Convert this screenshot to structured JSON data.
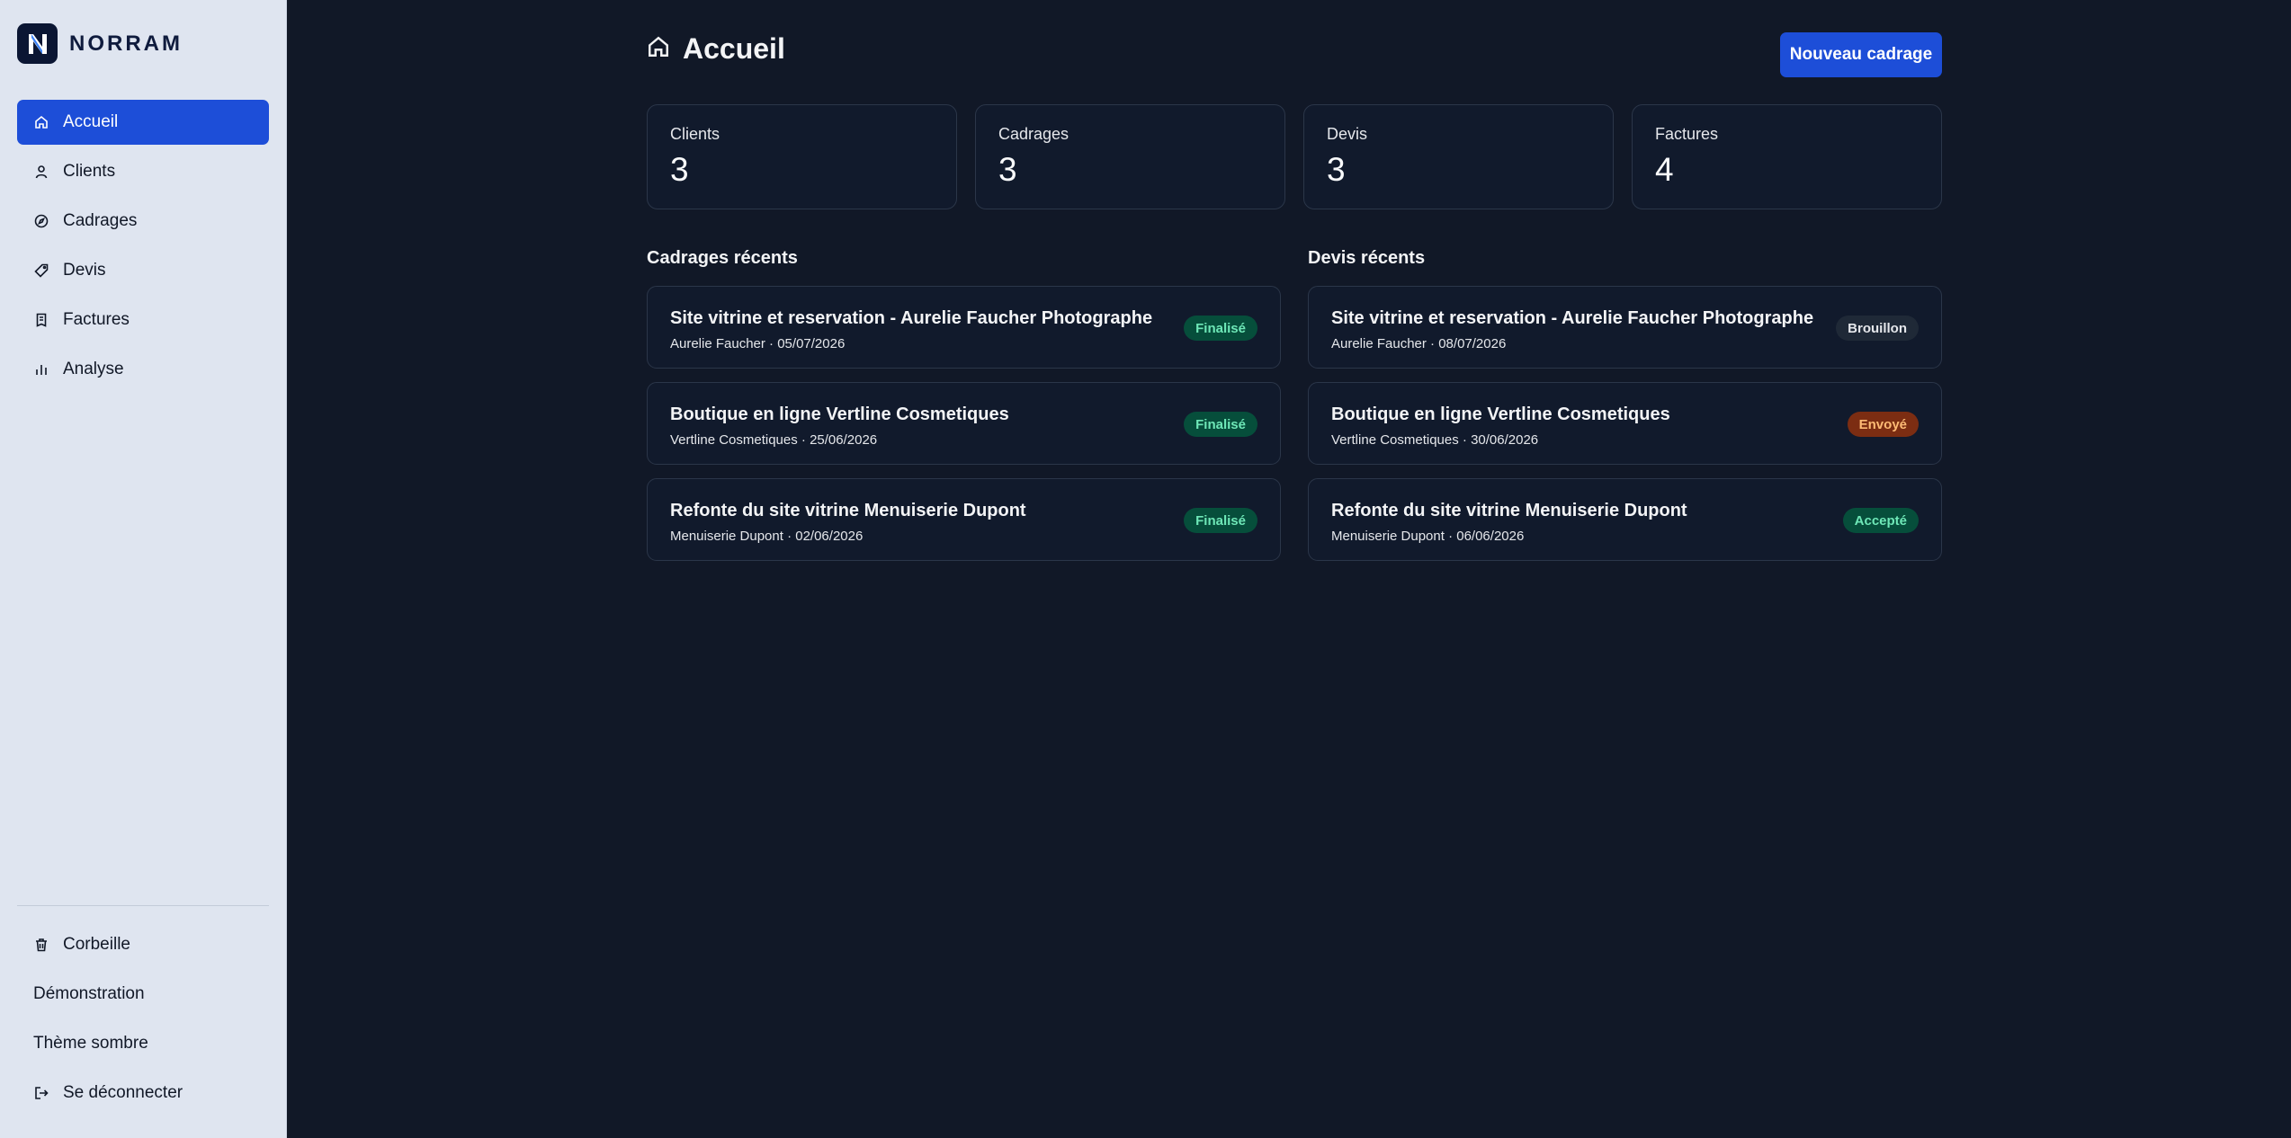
{
  "brand": {
    "name": "NORRAM"
  },
  "sidebar": {
    "items": [
      {
        "label": "Accueil",
        "icon": "home-icon",
        "active": true
      },
      {
        "label": "Clients",
        "icon": "user-icon"
      },
      {
        "label": "Cadrages",
        "icon": "compass-icon"
      },
      {
        "label": "Devis",
        "icon": "tag-icon"
      },
      {
        "label": "Factures",
        "icon": "receipt-icon"
      },
      {
        "label": "Analyse",
        "icon": "bar-chart-icon"
      }
    ],
    "bottom": [
      {
        "label": "Corbeille",
        "icon": "trash-icon"
      },
      {
        "label": "Démonstration"
      },
      {
        "label": "Thème sombre"
      },
      {
        "label": "Se déconnecter",
        "icon": "logout-icon"
      }
    ]
  },
  "header": {
    "title": "Accueil",
    "new_button": "Nouveau cadrage"
  },
  "stats": [
    {
      "label": "Clients",
      "value": "3"
    },
    {
      "label": "Cadrages",
      "value": "3"
    },
    {
      "label": "Devis",
      "value": "3"
    },
    {
      "label": "Factures",
      "value": "4"
    }
  ],
  "cadrages": {
    "title": "Cadrages récents",
    "items": [
      {
        "title": "Site vitrine et reservation - Aurelie Faucher Photographe",
        "sub": "Aurelie Faucher · 05/07/2026",
        "status": "Finalisé"
      },
      {
        "title": "Boutique en ligne Vertline Cosmetiques",
        "sub": "Vertline Cosmetiques · 25/06/2026",
        "status": "Finalisé"
      },
      {
        "title": "Refonte du site vitrine Menuiserie Dupont",
        "sub": "Menuiserie Dupont · 02/06/2026",
        "status": "Finalisé"
      }
    ]
  },
  "devis": {
    "title": "Devis récents",
    "items": [
      {
        "title": "Site vitrine et reservation - Aurelie Faucher Photographe",
        "sub": "Aurelie Faucher · 08/07/2026",
        "status": "Brouillon"
      },
      {
        "title": "Boutique en ligne Vertline Cosmetiques",
        "sub": "Vertline Cosmetiques · 30/06/2026",
        "status": "Envoyé"
      },
      {
        "title": "Refonte du site vitrine Menuiserie Dupont",
        "sub": "Menuiserie Dupont · 06/06/2026",
        "status": "Accepté"
      }
    ]
  },
  "colors": {
    "accent": "#1d4ed8",
    "background": "#111827",
    "sidebar": "#dfe5f0"
  }
}
